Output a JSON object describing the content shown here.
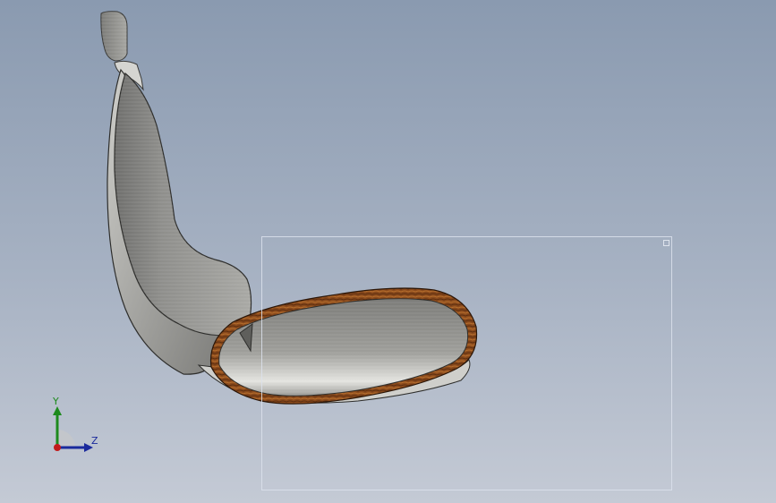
{
  "viewport": {
    "background_top": "#8a9ab0",
    "background_bottom": "#c4cad5"
  },
  "model": {
    "shell_color": "#8d8d8a",
    "trim_color": "#8a4a1c"
  },
  "triad": {
    "y_label": "Y",
    "z_label": "Z",
    "y_color": "#1d8a1d",
    "z_color": "#1a2a9c",
    "x_color": "#c21b1b",
    "icon": "coordinate-triad-icon"
  }
}
